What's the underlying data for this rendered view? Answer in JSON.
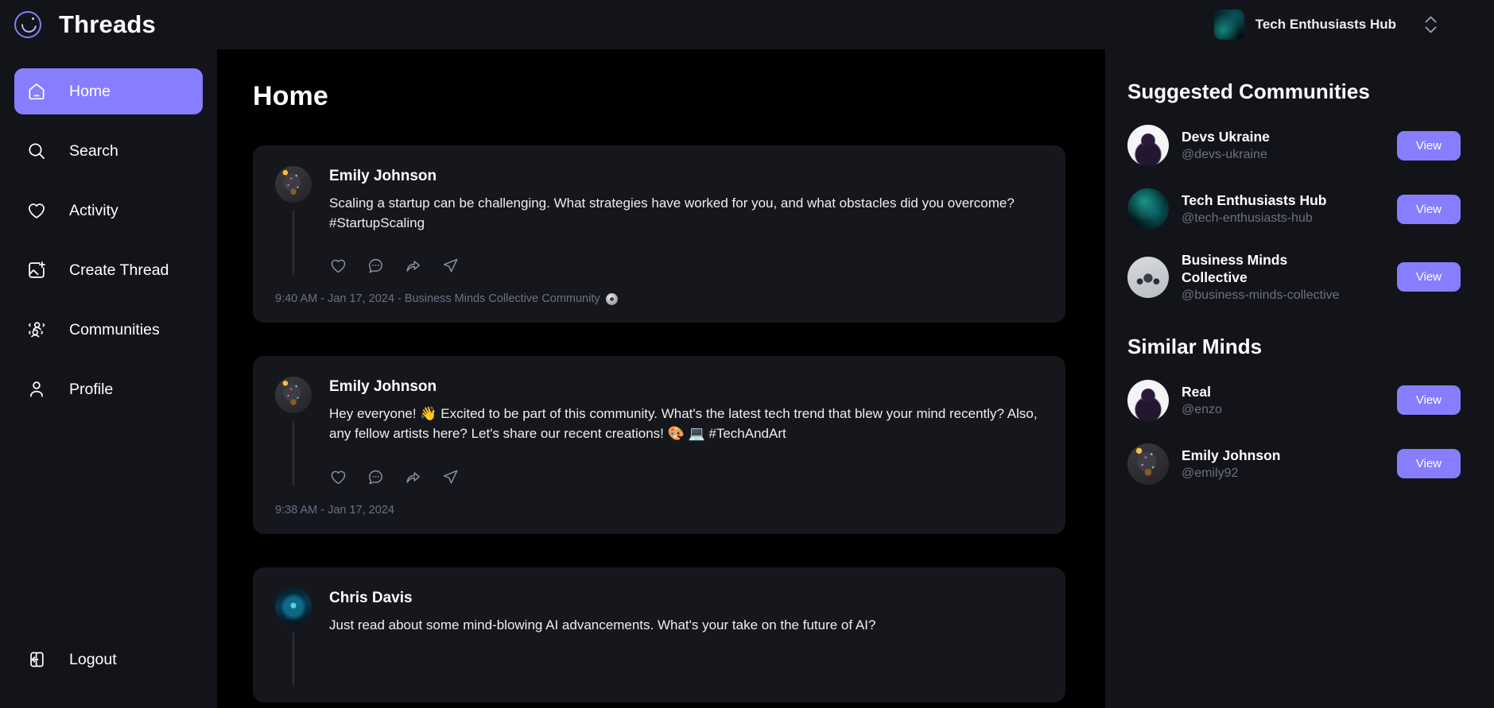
{
  "app": {
    "brand_title": "Threads",
    "logo_icon": "threads-moon-logo-icon",
    "accent_color": "#877eff",
    "background_color": "#131419",
    "content_background_color": "#000000",
    "card_background_color": "#16171d"
  },
  "topbar": {
    "org_name": "Tech Enthusiasts Hub",
    "org_avatar_icon": "org-thumbnail",
    "switch_icon": "chevron-up-down-icon"
  },
  "sidebar": {
    "items": [
      {
        "label": "Home",
        "icon": "home-icon",
        "active": true
      },
      {
        "label": "Search",
        "icon": "search-icon",
        "active": false
      },
      {
        "label": "Activity",
        "icon": "heart-icon",
        "active": false
      },
      {
        "label": "Create Thread",
        "icon": "create-post-icon",
        "active": false
      },
      {
        "label": "Communities",
        "icon": "users-group-icon",
        "active": false
      },
      {
        "label": "Profile",
        "icon": "user-icon",
        "active": false
      }
    ],
    "logout": {
      "label": "Logout",
      "icon": "logout-icon"
    }
  },
  "main": {
    "page_title": "Home",
    "posts": [
      {
        "author": "Emily Johnson",
        "avatar_icon": "avatar-emily-johnson",
        "text": "Scaling a startup can be challenging. What strategies have worked for you, and what obstacles did you overcome? #StartupScaling",
        "time": "9:40 AM",
        "date": "Jan 17, 2024",
        "community": "Business Minds Collective Community",
        "meta": "9:40 AM - Jan 17, 2024 - Business Minds Collective Community",
        "has_community_badge": true,
        "actions": [
          "like-icon",
          "reply-icon",
          "repost-icon",
          "share-icon"
        ]
      },
      {
        "author": "Emily Johnson",
        "avatar_icon": "avatar-emily-johnson",
        "text": "Hey everyone! 👋 Excited to be part of this community. What's the latest tech trend that blew your mind recently? Also, any fellow artists here? Let's share our recent creations! 🎨 💻 #TechAndArt",
        "time": "9:38 AM",
        "date": "Jan 17, 2024",
        "community": "",
        "meta": "9:38 AM - Jan 17, 2024",
        "has_community_badge": false,
        "actions": [
          "like-icon",
          "reply-icon",
          "repost-icon",
          "share-icon"
        ]
      },
      {
        "author": "Chris Davis",
        "avatar_icon": "avatar-chris-davis",
        "text": "Just read about some mind-blowing AI advancements. What's your take on the future of AI?",
        "time": "",
        "date": "",
        "community": "",
        "meta": "",
        "has_community_badge": false,
        "actions": []
      }
    ]
  },
  "rightbar": {
    "suggested_heading": "Suggested Communities",
    "communities": [
      {
        "name": "Devs Ukraine",
        "handle": "@devs-ukraine",
        "button": "View",
        "avatar_icon": "avatar-devs-ukraine"
      },
      {
        "name": "Tech Enthusiasts Hub",
        "handle": "@tech-enthusiasts-hub",
        "button": "View",
        "avatar_icon": "avatar-tech-enthusiasts-hub"
      },
      {
        "name": "Business Minds Collective",
        "handle": "@business-minds-collective",
        "button": "View",
        "avatar_icon": "avatar-business-minds-collective"
      }
    ],
    "similar_heading": "Similar Minds",
    "users": [
      {
        "name": "Real",
        "handle": "@enzo",
        "button": "View",
        "avatar_icon": "avatar-real-enzo"
      },
      {
        "name": "Emily Johnson",
        "handle": "@emily92",
        "button": "View",
        "avatar_icon": "avatar-emily-johnson"
      }
    ]
  }
}
